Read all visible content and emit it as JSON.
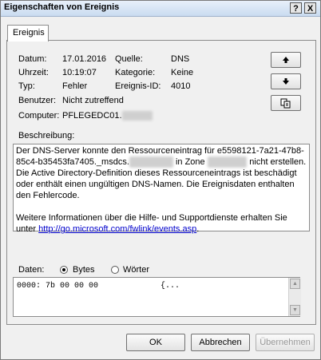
{
  "window": {
    "title": "Eigenschaften von Ereignis",
    "help_label": "?",
    "close_label": "X"
  },
  "tab": {
    "label": "Ereignis"
  },
  "fields": {
    "datum_label": "Datum:",
    "datum_value": "17.01.2016",
    "uhrzeit_label": "Uhrzeit:",
    "uhrzeit_value": "10:19:07",
    "typ_label": "Typ:",
    "typ_value": "Fehler",
    "benutzer_label": "Benutzer:",
    "benutzer_value": "Nicht zutreffend",
    "computer_label": "Computer:",
    "computer_value": "PFLEGEDC01.",
    "quelle_label": "Quelle:",
    "quelle_value": "DNS",
    "kategorie_label": "Kategorie:",
    "kategorie_value": "Keine",
    "ereignis_id_label": "Ereignis-ID:",
    "ereignis_id_value": "4010"
  },
  "nav": {
    "up_icon": "arrow-up-icon",
    "down_icon": "arrow-down-icon",
    "copy_icon": "copy-icon"
  },
  "description": {
    "label": "Beschreibung:",
    "text_1": "Der DNS-Server konnte den Ressourceneintrag für e5598121-7a21-47b8-85c4-b35453fa7405._msdcs.",
    "text_2": " in Zone ",
    "text_3": " nicht erstellen. Die Active Directory-Definition dieses Ressourceneintrags ist beschädigt oder enthält einen ungültigen DNS-Namen. Die Ereignisdaten enthalten den Fehlercode.",
    "text_4": "Weitere Informationen über die Hilfe- und Supportdienste erhalten Sie unter ",
    "link": "http://go.microsoft.com/fwlink/events.asp",
    "text_5": "."
  },
  "data_section": {
    "label": "Daten:",
    "bytes_label": "Bytes",
    "woerter_label": "Wörter",
    "selected": "Bytes",
    "content": "0000: 7b 00 00 00             {..."
  },
  "buttons": {
    "ok": "OK",
    "abbrechen": "Abbrechen",
    "uebernehmen": "Übernehmen"
  }
}
